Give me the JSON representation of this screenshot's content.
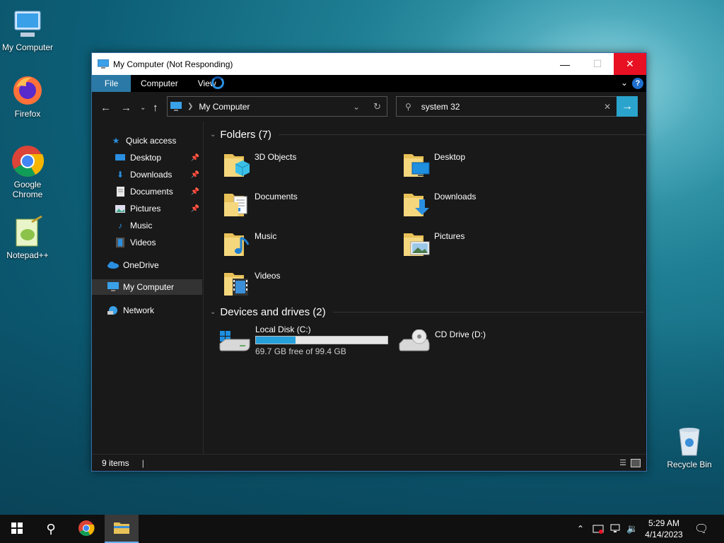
{
  "desktop": {
    "icons": [
      {
        "label": "My Computer"
      },
      {
        "label": "Firefox"
      },
      {
        "label": "Google Chrome"
      },
      {
        "label": "Notepad++"
      },
      {
        "label": "Recycle Bin"
      }
    ]
  },
  "window": {
    "title": "My Computer (Not Responding)",
    "ribbon_tabs": [
      "File",
      "Computer",
      "View"
    ],
    "address": "My Computer",
    "search_value": "system 32",
    "nav": {
      "quick_access": "Quick access",
      "items": [
        {
          "label": "Desktop",
          "pinned": true
        },
        {
          "label": "Downloads",
          "pinned": true
        },
        {
          "label": "Documents",
          "pinned": true
        },
        {
          "label": "Pictures",
          "pinned": true
        },
        {
          "label": "Music",
          "pinned": false
        },
        {
          "label": "Videos",
          "pinned": false
        }
      ],
      "onedrive": "OneDrive",
      "my_computer": "My Computer",
      "network": "Network"
    },
    "folders_header": "Folders (7)",
    "folders": [
      "3D Objects",
      "Desktop",
      "Documents",
      "Downloads",
      "Music",
      "Pictures",
      "Videos"
    ],
    "devices_header": "Devices and drives (2)",
    "drives": [
      {
        "name": "Local Disk (C:)",
        "free_text": "69.7 GB free of 99.4 GB",
        "used_fraction": 0.3
      },
      {
        "name": "CD Drive (D:)"
      }
    ],
    "status": "9 items"
  },
  "taskbar": {
    "time": "5:29 AM",
    "date": "4/14/2023"
  },
  "colors": {
    "accent": "#2aa4cc",
    "close": "#e81123",
    "folder": "#e8c158"
  }
}
